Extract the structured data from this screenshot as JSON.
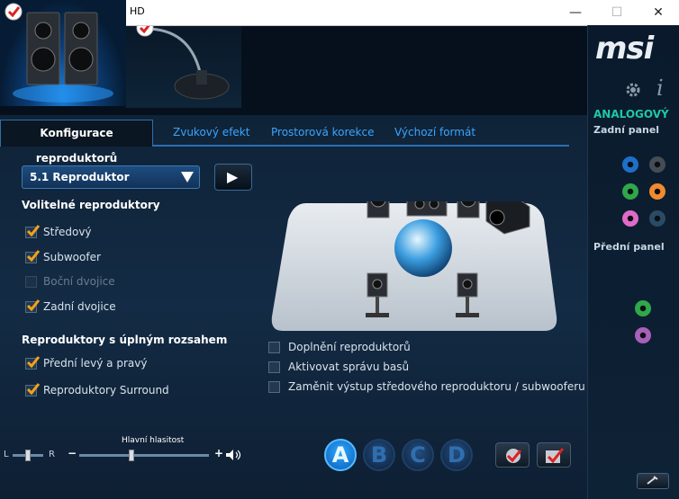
{
  "window": {
    "title_fragment": "HD",
    "minimize": "—",
    "maximize": "☐",
    "close": "✕"
  },
  "brand": "msi",
  "right_panel": {
    "mode_label": "ANALOGOVÝ",
    "rear_panel": "Zadní panel",
    "front_panel": "Přední panel",
    "rear_jacks": [
      "#1e6fc8",
      "#444c55",
      "#2ea84a",
      "#f08a2e",
      "#e06ac8",
      "#2a4a66"
    ],
    "front_jacks": [
      "#2ea84a",
      "#a860b8"
    ]
  },
  "tabs": {
    "active": "Konfigurace reproduktorů",
    "items": [
      "Zvukový efekt",
      "Prostorová korekce",
      "Výchozí formát"
    ]
  },
  "speaker_config": {
    "selected": "5.1 Reproduktor",
    "play_label": "▶"
  },
  "optional_speakers": {
    "heading": "Volitelné reproduktory",
    "items": [
      {
        "label": "Středový",
        "checked": true,
        "disabled": false
      },
      {
        "label": "Subwoofer",
        "checked": true,
        "disabled": false
      },
      {
        "label": "Boční dvojice",
        "checked": false,
        "disabled": true
      },
      {
        "label": "Zadní dvojice",
        "checked": true,
        "disabled": false
      }
    ]
  },
  "fullrange": {
    "heading": "Reproduktory s úplným rozsahem",
    "items": [
      {
        "label": "Přední levý a pravý",
        "checked": true
      },
      {
        "label": "Reproduktory Surround",
        "checked": true
      }
    ]
  },
  "options": {
    "items": [
      {
        "label": "Doplnění reproduktorů",
        "checked": false
      },
      {
        "label": "Aktivovat správu basů",
        "checked": false
      },
      {
        "label": "Zaměnit výstup středového reproduktoru / subwooferu",
        "checked": false
      }
    ]
  },
  "volume": {
    "label": "Hlavní hlasitost",
    "left": "L",
    "right": "R",
    "minus": "−",
    "plus": "+",
    "balance": 0.5,
    "level": 0.4
  },
  "profiles": {
    "items": [
      "A",
      "B",
      "C",
      "D"
    ],
    "selected": "A"
  }
}
